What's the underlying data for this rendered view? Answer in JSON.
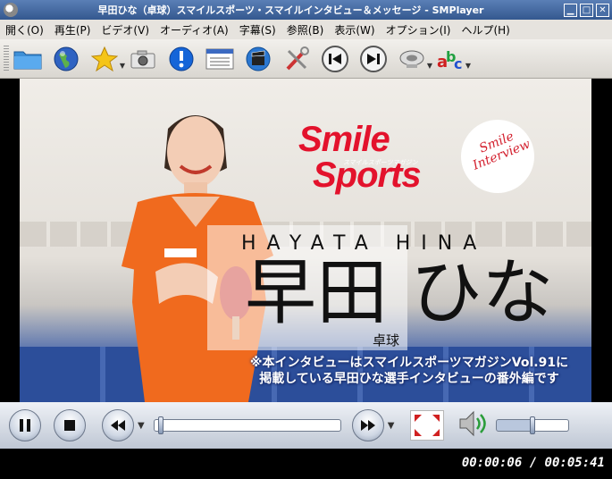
{
  "window": {
    "title": "早田ひな（卓球）スマイルスポーツ・スマイルインタビュー＆メッセージ - SMPlayer",
    "minimize_label": "▁",
    "maximize_label": "□",
    "close_label": "✕"
  },
  "menu": {
    "items": [
      "開く(O)",
      "再生(P)",
      "ビデオ(V)",
      "オーディオ(A)",
      "字幕(S)",
      "参照(B)",
      "表示(W)",
      "オプション(I)",
      "ヘルプ(H)"
    ]
  },
  "toolbar": {
    "icons": [
      "folder-icon",
      "globe-icon",
      "favorites-star-icon",
      "screenshot-camera-icon",
      "info-icon",
      "playlist-icon",
      "video-clapper-icon",
      "tools-icon",
      "previous-icon",
      "next-icon",
      "audio-track-icon",
      "subtitle-abc-icon"
    ]
  },
  "video": {
    "logo_line1": "Smile",
    "logo_line2": "Sports",
    "logo_subtitle": "スマイルスポーツマガジン",
    "badge_text": "Smile Interview",
    "name_romaji": "HAYATA HINA",
    "name_japanese": "早田 ひな",
    "sport": "卓球",
    "caption_line1": "※本インタビューはスマイルスポーツマガジンVol.91に",
    "caption_line2": "掲載している早田ひな選手インタビューの番外編です"
  },
  "playback": {
    "current_time": "00:00:06",
    "total_time": "00:05:41",
    "time_display": "00:00:06 / 00:05:41",
    "progress_fraction": 0.018,
    "volume_fraction": 0.5
  },
  "colors": {
    "brand_red": "#e3122c",
    "jersey_orange": "#f06a1e",
    "floor_blue": "#2c4e9a"
  }
}
